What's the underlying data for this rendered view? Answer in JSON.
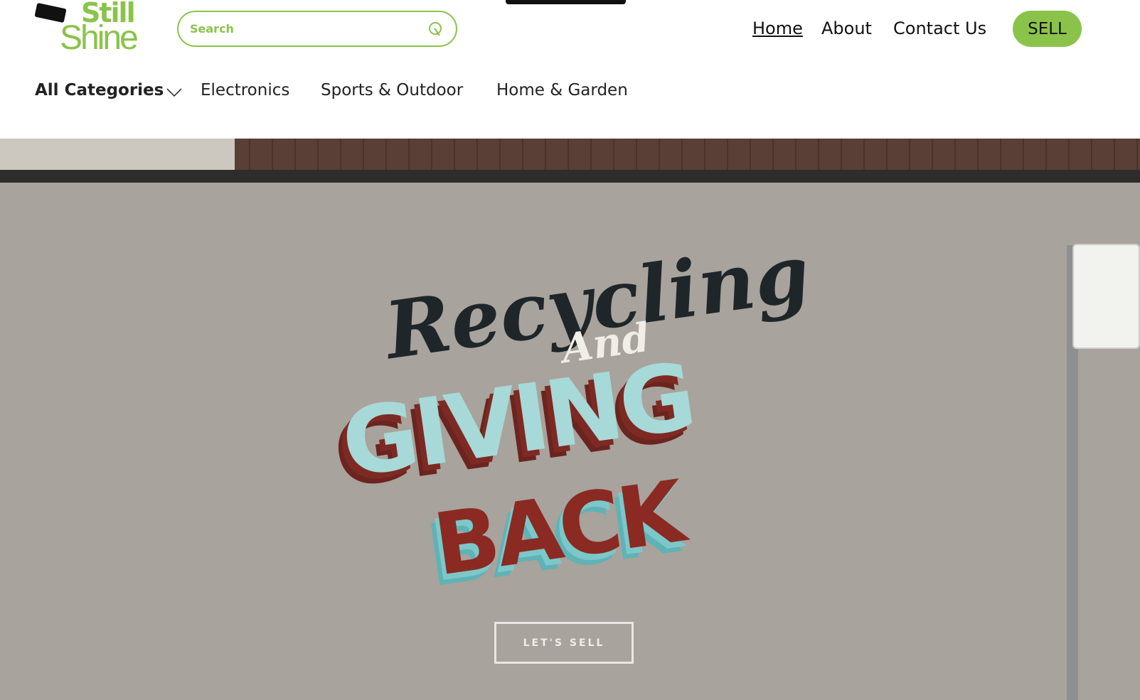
{
  "logo": {
    "line1": "Still",
    "line2": "Shine"
  },
  "search": {
    "placeholder": "Search"
  },
  "nav": {
    "items": [
      {
        "label": "Home"
      },
      {
        "label": "About"
      },
      {
        "label": "Contact Us"
      }
    ],
    "sell_label": "SELL"
  },
  "categories": {
    "all_label": "All Categories",
    "items": [
      {
        "label": "Electronics"
      },
      {
        "label": "Sports & Outdoor"
      },
      {
        "label": "Home & Garden"
      }
    ]
  },
  "hero": {
    "mural_line1": "Recycling",
    "mural_line2": "And",
    "mural_line3": "GIVING",
    "mural_line4": "BACK",
    "cta_label": "LET'S SELL"
  },
  "colors": {
    "brand": "#8bc34a"
  }
}
